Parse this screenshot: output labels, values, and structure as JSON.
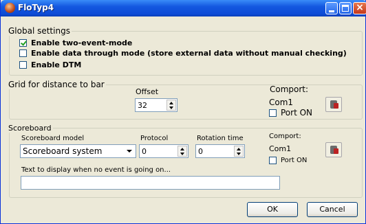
{
  "window": {
    "title": "FloTyp4"
  },
  "global": {
    "legend": "Global settings",
    "options": [
      {
        "label": "Enable two-event-mode",
        "checked": true
      },
      {
        "label": "Enable data through mode (store external data without manual checking)",
        "checked": false
      },
      {
        "label": "Enable DTM",
        "checked": false
      }
    ]
  },
  "grid": {
    "legend": "Grid for distance to bar",
    "offset_label": "Offset",
    "offset_value": "32",
    "comport_label": "Comport:",
    "com_name": "Com1",
    "port_on_label": "Port ON",
    "port_on_checked": false
  },
  "scoreboard": {
    "legend": "Scoreboard",
    "model_label": "Scoreboard model",
    "model_value": "Scoreboard system",
    "protocol_label": "Protocol",
    "protocol_value": "0",
    "rotation_label": "Rotation time",
    "rotation_value": "0",
    "comport_label": "Comport:",
    "com_name": "Com1",
    "port_on_label": "Port ON",
    "port_on_checked": false,
    "text_label": "Text to display when no event is going on...",
    "text_value": ""
  },
  "buttons": {
    "ok": "OK",
    "cancel": "Cancel"
  },
  "icons": {
    "app": "app-icon",
    "port": "port-settings-icon"
  }
}
